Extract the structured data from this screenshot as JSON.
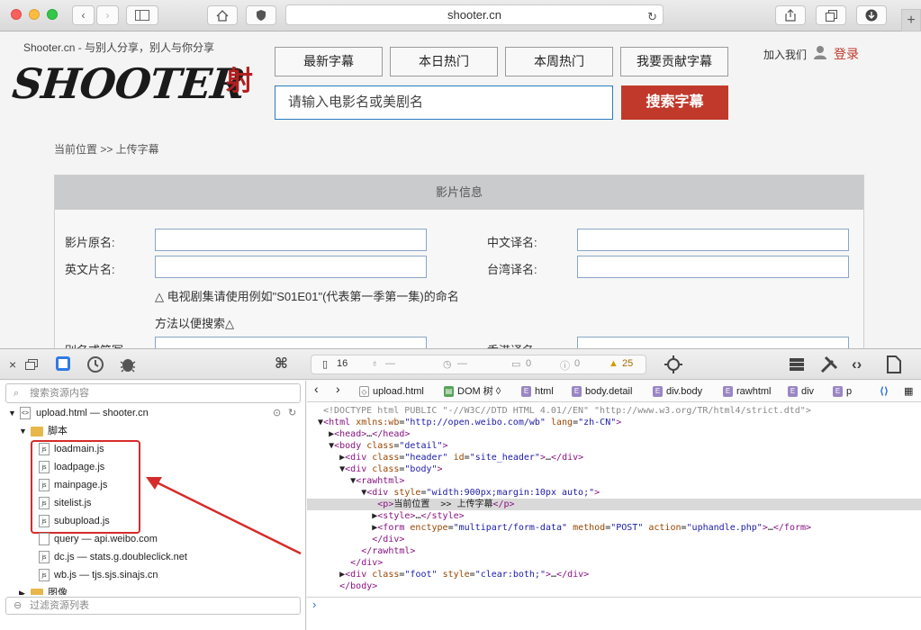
{
  "browser": {
    "url": "shooter.cn",
    "reload_icon": "reload-icon"
  },
  "site": {
    "tagline": "Shooter.cn - 与别人分享，别人与你分享",
    "logo_text": "SHOOTER",
    "logo_seal": "射",
    "nav": [
      "最新字幕",
      "本日热门",
      "本周热门",
      "我要贡献字幕"
    ],
    "join_us": "加入我们",
    "login": "登录",
    "search_placeholder": "请输入电影名或美剧名",
    "search_button": "搜索字幕",
    "breadcrumb": "当前位置 >> 上传字幕",
    "info_title": "影片信息",
    "fields": {
      "original_name": "影片原名:",
      "chinese_name": "中文译名:",
      "english_name": "英文片名:",
      "taiwan_name": "台湾译名:",
      "alias": "别名或简写:",
      "hongkong_name": "香港译名:"
    },
    "note_line1": "△ 电视剧集请使用例如\"S01E01\"(代表第一季第一集)的命名",
    "note_line2": "方法以便搜索△"
  },
  "devtools": {
    "stats": {
      "resources": "16",
      "errors": "0",
      "warnings": "25",
      "dash1": "—",
      "dash2": "—",
      "logs": "0"
    },
    "resource_filter_placeholder": "搜索资源内容",
    "resources_bottom_placeholder": "过滤资源列表",
    "tree": {
      "root": "upload.html — shooter.cn",
      "scripts_folder": "脚本",
      "scripts": [
        "loadmain.js",
        "loadpage.js",
        "mainpage.js",
        "sitelist.js",
        "subupload.js"
      ],
      "others": [
        "query — api.weibo.com",
        "dc.js — stats.g.doubleclick.net",
        "wb.js — tjs.sjs.sinajs.cn"
      ],
      "images_folder": "图像"
    },
    "breadcrumb": [
      "upload.html",
      "DOM 树",
      "html",
      "body.detail",
      "div.body",
      "rawhtml",
      "div",
      "p"
    ],
    "dom": {
      "doctype": "<!DOCTYPE html PUBLIC \"-//W3C//DTD HTML 4.01//EN\" \"http://www.w3.org/TR/html4/strict.dtd\">",
      "selected_p_text": "当前位置  >> 上传字幕"
    }
  }
}
